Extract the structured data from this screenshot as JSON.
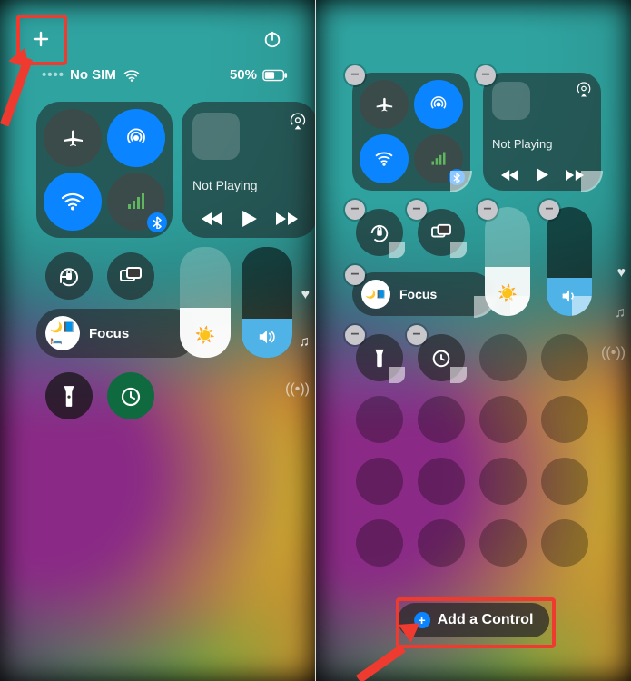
{
  "left": {
    "status": {
      "carrier": "No SIM",
      "battery": "50%"
    },
    "media": {
      "not_playing": "Not Playing"
    },
    "focus": {
      "label": "Focus"
    },
    "brightness_pct": 45,
    "volume_pct": 35
  },
  "right": {
    "media": {
      "not_playing": "Not Playing"
    },
    "focus": {
      "label": "Focus"
    },
    "brightness_pct": 45,
    "volume_pct": 35,
    "add_control": "Add a Control"
  },
  "colors": {
    "accent": "#0a84ff",
    "callout": "#ef3b2f"
  }
}
